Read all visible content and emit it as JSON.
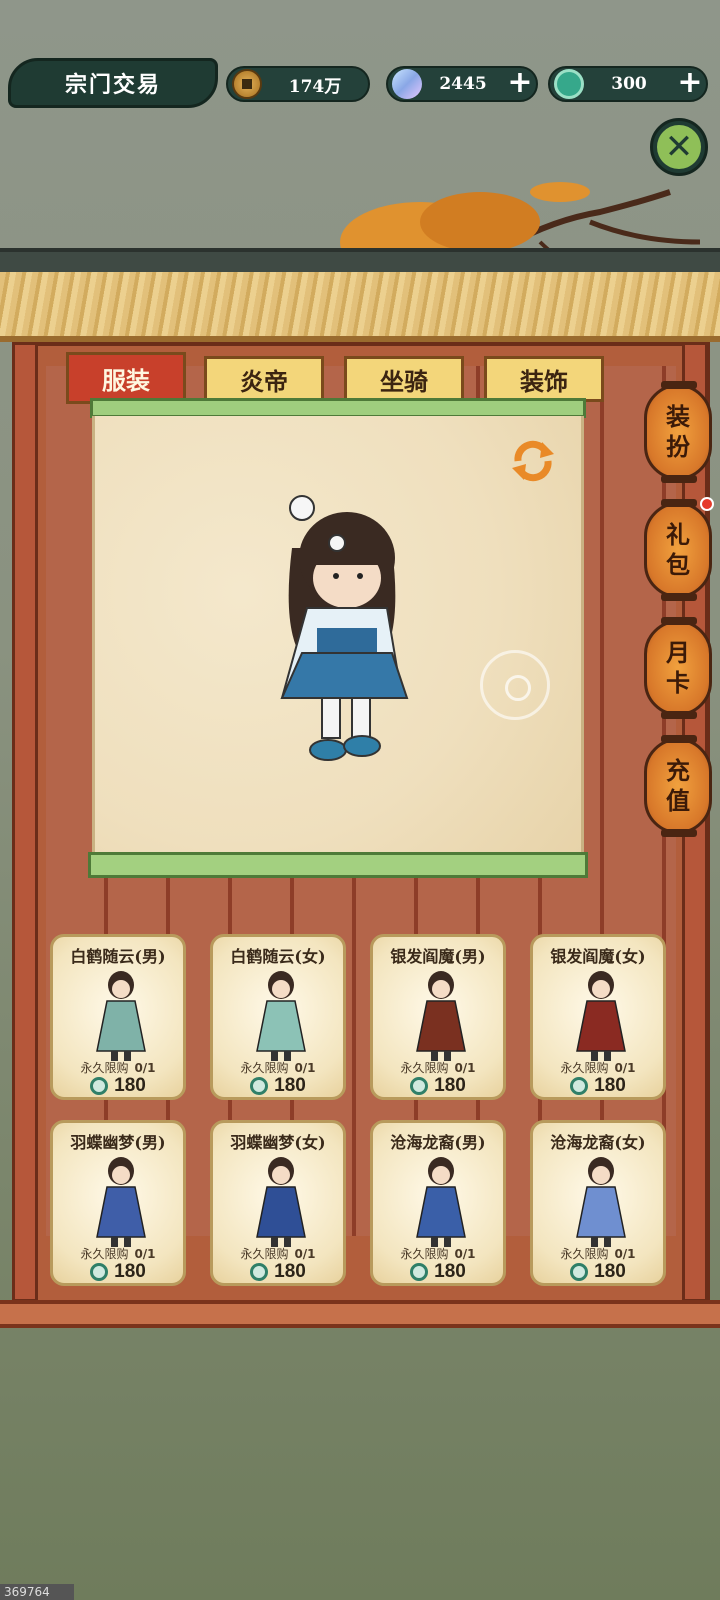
{
  "header": {
    "title": "宗门交易",
    "coins": "174万",
    "gems": "2445",
    "jade": "300"
  },
  "tabs": [
    {
      "label": "服装",
      "active": true
    },
    {
      "label": "炎帝",
      "active": false
    },
    {
      "label": "坐骑",
      "active": false
    },
    {
      "label": "装饰",
      "active": false
    }
  ],
  "side_menu": [
    {
      "label_top": "装",
      "label_bottom": "扮"
    },
    {
      "label_top": "礼",
      "label_bottom": "包"
    },
    {
      "label_top": "月",
      "label_bottom": "卡"
    },
    {
      "label_top": "充",
      "label_bottom": "值"
    }
  ],
  "items": [
    {
      "name": "白鹤随云(男)",
      "limit_label": "永久限购",
      "limit": "0/1",
      "price": "180",
      "color": "#7fb2a8"
    },
    {
      "name": "白鹤随云(女)",
      "limit_label": "永久限购",
      "limit": "0/1",
      "price": "180",
      "color": "#8cc2b6"
    },
    {
      "name": "银发阎魔(男)",
      "limit_label": "永久限购",
      "limit": "0/1",
      "price": "180",
      "color": "#7a3020"
    },
    {
      "name": "银发阎魔(女)",
      "limit_label": "永久限购",
      "limit": "0/1",
      "price": "180",
      "color": "#8a2a22"
    },
    {
      "name": "羽蝶幽梦(男)",
      "limit_label": "永久限购",
      "limit": "0/1",
      "price": "180",
      "color": "#3f5ea8"
    },
    {
      "name": "羽蝶幽梦(女)",
      "limit_label": "永久限购",
      "limit": "0/1",
      "price": "180",
      "color": "#2f4f96"
    },
    {
      "name": "沧海龙裔(男)",
      "limit_label": "永久限购",
      "limit": "0/1",
      "price": "180",
      "color": "#3a5fa8"
    },
    {
      "name": "沧海龙裔(女)",
      "limit_label": "永久限购",
      "limit": "0/1",
      "price": "180",
      "color": "#6f8fd0"
    }
  ],
  "watermark": "369764"
}
